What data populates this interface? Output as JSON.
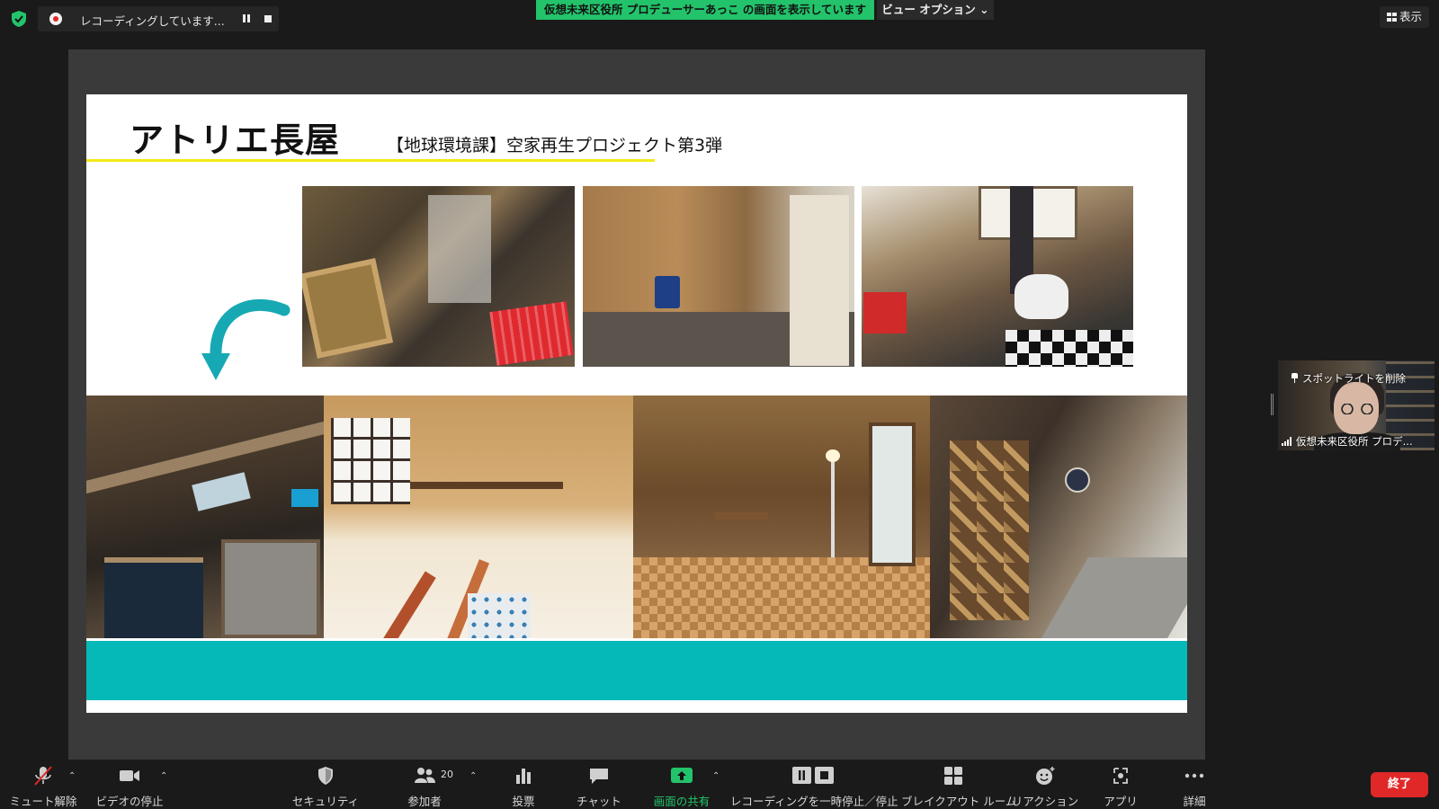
{
  "recording": {
    "status_text": "レコーディングしています..."
  },
  "share_banner": {
    "text": "仮想未来区役所 プロデューサーあっこ の画面を表示しています"
  },
  "view_options": {
    "label": "ビュー オプション ⌄"
  },
  "display_button": {
    "label": "表示"
  },
  "slide": {
    "title": "アトリエ長屋",
    "subtitle": "【地球環境課】空家再生プロジェクト第3弾"
  },
  "spotlight": {
    "remove_label": "スポットライトを削除",
    "participant_name": "仮想未来区役所 プロデ..."
  },
  "toolbar": {
    "mute_label": "ミュート解除",
    "video_label": "ビデオの停止",
    "security_label": "セキュリティ",
    "participants_label": "参加者",
    "participants_count": "20",
    "polls_label": "投票",
    "chat_label": "チャット",
    "share_label": "画面の共有",
    "recording_label": "レコーディングを一時停止／停止",
    "breakout_label": "ブレイクアウト ルーム",
    "reactions_label": "リアクション",
    "apps_label": "アプリ",
    "more_label": "詳細",
    "end_label": "終了"
  },
  "colors": {
    "share_banner": "#23c36b",
    "end_button": "#e02828",
    "slide_accent_teal": "#04b9b8",
    "slide_underline_yellow": "#f4ea17",
    "share_active_green": "#23c36b"
  }
}
